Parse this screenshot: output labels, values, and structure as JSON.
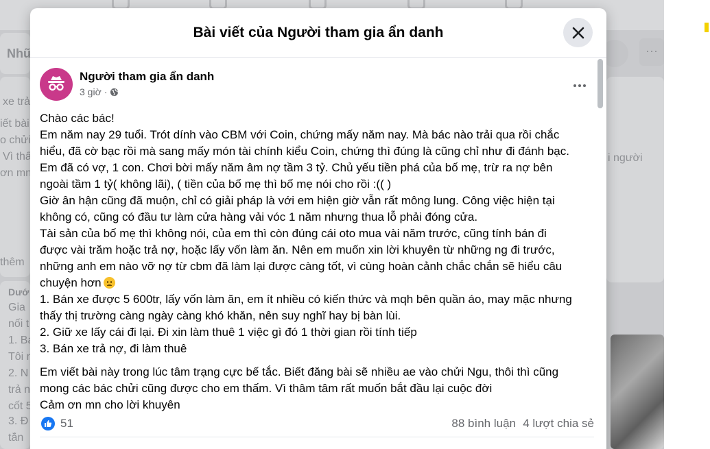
{
  "background": {
    "left_texts": [
      "Nhữ",
      "xe trả",
      "iết bài",
      "o chửi",
      "Vì thấ",
      "ơn mn",
      "thêm",
      "Dướ",
      "Gia",
      "nối t",
      "1. Bá",
      "Tôi n",
      "2. N",
      "trả n",
      "cốt 5",
      "3. Đ",
      "tắn"
    ],
    "right_text": "i người"
  },
  "modal": {
    "title": "Bài viết của Người tham gia ẩn danh",
    "close_icon": "close-icon"
  },
  "post": {
    "author": "Người tham gia ẩn danh",
    "time": "3 giờ",
    "separator": "·",
    "privacy_icon": "globe-icon",
    "avatar_icon": "anonymous-icon",
    "paragraphs": [
      [
        "Chào các bác!",
        "Em năm nay 29 tuổi. Trót dính vào CBM với Coin, chứng mấy năm nay. Mà bác nào trải qua rồi chắc",
        "hiểu, đã cờ bạc rồi mà sang mấy món tài chính kiểu Coin, chứng thì đúng là cũng chỉ như đi đánh bạc.",
        "Em đã có vợ, 1 con. Chơi bời mấy năm âm nợ tầm 3 tỷ. Chủ yếu tiền phá của bố mẹ, trừ ra nợ bên",
        "ngoài tầm 1 tỷ( không lãi),  ( tiền của bố mẹ thì bố mẹ nói cho rồi :(( )",
        "Giờ ân hận cũng đã muộn, chỉ có giải pháp là với em hiện giờ vẫn rất mông lung. Công việc hiện tại",
        "không có, cũng có đầu tư làm cửa hàng vải vóc 1 năm nhưng thua lỗ phải đóng cửa.",
        "Tài sản của bố mẹ thì không nói, của em thì còn đúng cái oto mua vài năm trước, cũng tính bán đi",
        "được vài trăm hoặc trả nợ, hoặc lấy vốn làm ăn. Nên em muốn xin lời khuyên từ những ng đi trước,",
        "những anh em nào vỡ nợ từ cbm đã làm lại được càng tốt, vì cùng hoàn cảnh chắc chắn sẽ hiểu câu",
        "chuyện hơn",
        "1. Bán xe được 5 600tr, lấy vốn làm ăn, em ít nhiều có kiến thức và mqh bên quần áo, may mặc nhưng",
        "thấy thị trường càng ngày càng khó khăn, nên suy nghĩ hay bị bàn lùi.",
        "2. Giữ xe lấy cái đi lại. Đi xin làm thuê 1 việc gì đó 1 thời gian rồi tính tiếp",
        "3. Bán xe trả nợ, đi làm thuê"
      ],
      [
        "Em viết bài này trong lúc tâm trạng cực bế tắc. Biết đăng bài sẽ nhiều ae vào chửi Ngu, thôi thì cũng",
        "mong các bác chửi cũng được cho em thấm. Vì thâm tâm rất muốn bắt đầu lại cuộc đời",
        "Cảm ơn mn cho lời khuyên"
      ]
    ],
    "emoji_icon": "sad-face-icon",
    "reactions": {
      "icon": "like-icon",
      "count": "51"
    },
    "comments": "88 bình luận",
    "shares": "4 lượt chia sẻ"
  },
  "colors": {
    "accent": "#1877f2",
    "avatar": "#c9398a",
    "secondary_text": "#65676b"
  }
}
